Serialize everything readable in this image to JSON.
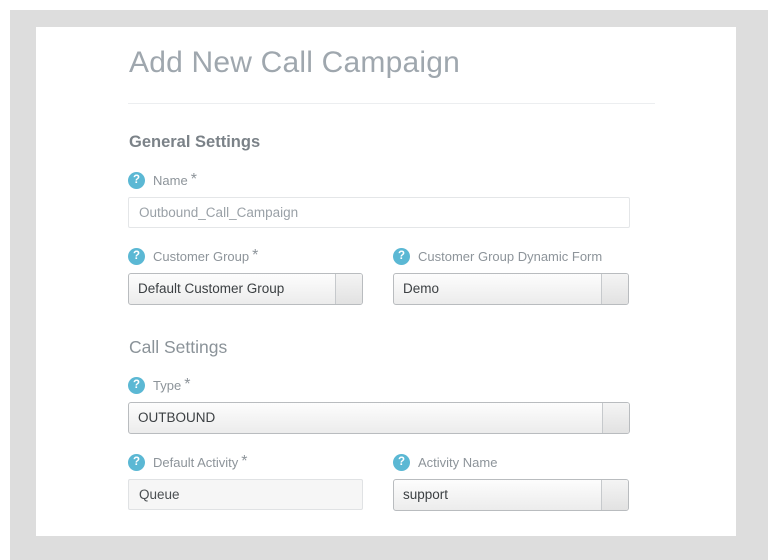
{
  "page": {
    "title": "Add New Call Campaign"
  },
  "sections": [
    {
      "heading": "General Settings",
      "fields": [
        {
          "label": "Name",
          "required_marker": "*",
          "help_icon": "question-mark-icon",
          "control": "text",
          "value": "Outbound_Call_Campaign",
          "placeholder": "Outbound_Call_Campaign"
        },
        {
          "label": "Customer Group",
          "required_marker": "*",
          "help_icon": "question-mark-icon",
          "control": "select",
          "value": "Default Customer Group"
        },
        {
          "label": "Customer Group Dynamic Form",
          "required_marker": "",
          "help_icon": "question-mark-icon",
          "control": "select",
          "value": "Demo"
        }
      ]
    },
    {
      "heading": "Call Settings",
      "fields": [
        {
          "label": "Type",
          "required_marker": "*",
          "help_icon": "question-mark-icon",
          "control": "select",
          "value": "OUTBOUND"
        },
        {
          "label": "Default Activity",
          "required_marker": "*",
          "help_icon": "question-mark-icon",
          "control": "readonly",
          "value": "Queue"
        },
        {
          "label": "Activity Name",
          "required_marker": "",
          "help_icon": "question-mark-icon",
          "control": "select",
          "value": "support"
        }
      ]
    }
  ],
  "icons": {
    "help": "?"
  },
  "colors": {
    "help_icon_background": "#5bb8d4",
    "title_text": "#9fa7ae",
    "heading_text": "#7b8288",
    "label_text": "#8d949a",
    "page_background": "#dddddd",
    "card_background": "#ffffff"
  }
}
